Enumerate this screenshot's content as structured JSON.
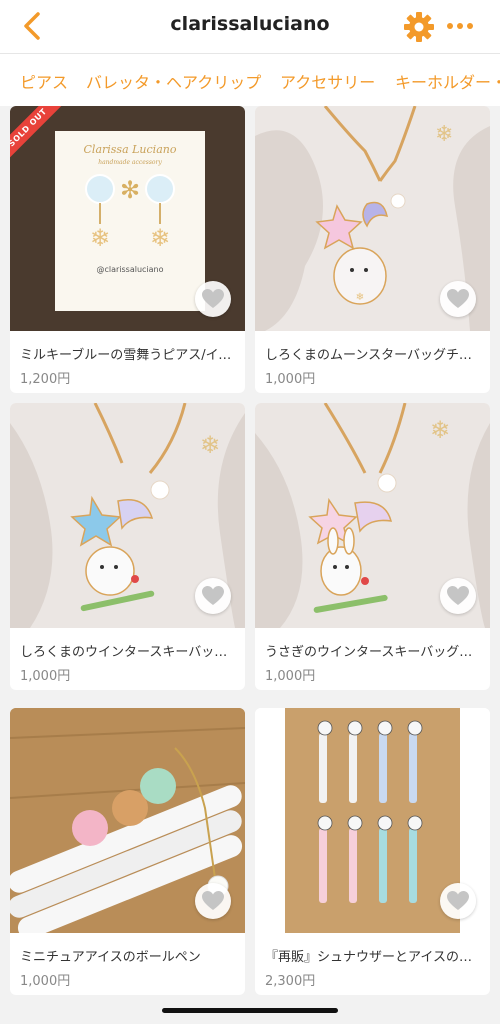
{
  "header": {
    "title": "clarissaluciano",
    "back_icon": "chevron-left-icon",
    "settings_icon": "gear-icon",
    "more_icon": "more-dots-icon",
    "accent": "#f39a2a"
  },
  "tabs": [
    "ピアス",
    "バレッタ・ヘアクリップ",
    "アクセサリー",
    "キーホルダー・"
  ],
  "products": [
    {
      "name": "ミルキーブルーの雪舞うピアス/イヤリング",
      "price": "1,200円",
      "badge": "SOLD OUT",
      "card_text": "Clarissa Luciano",
      "card_sub": "handmade accessory",
      "card_handle": "@clarissaluciano"
    },
    {
      "name": "しろくまのムーンスターバッグチャーム",
      "price": "1,000円"
    },
    {
      "name": "しろくまのウインタースキーバッグチャーム",
      "price": "1,000円"
    },
    {
      "name": "うさぎのウインタースキーバッグチャーム",
      "price": "1,000円"
    },
    {
      "name": "ミニチュアアイスのボールペン",
      "price": "1,000円"
    },
    {
      "name": "『再販』シュナウザーとアイスのボールペン",
      "price": "2,300円"
    }
  ]
}
